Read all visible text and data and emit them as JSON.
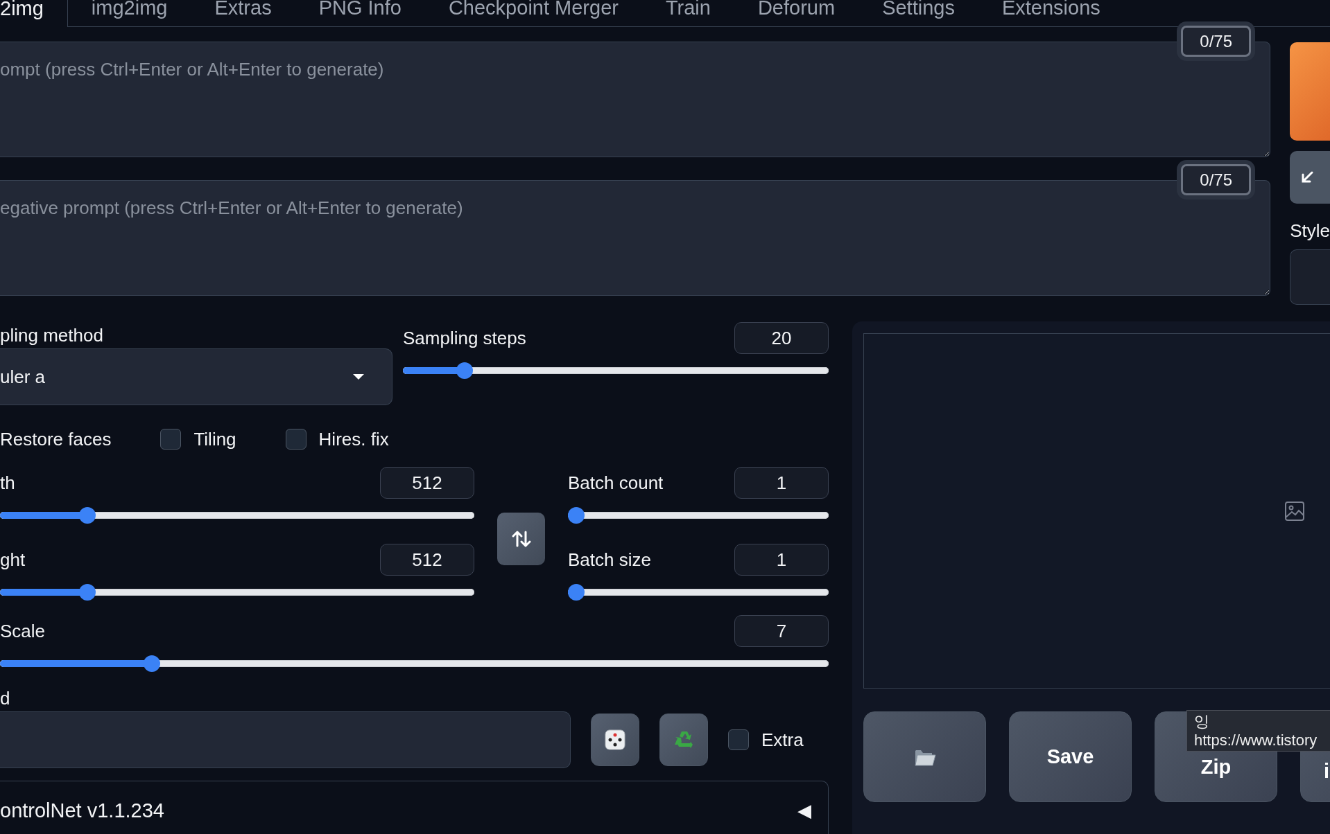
{
  "tabs": [
    {
      "label": "2img",
      "selected": true
    },
    {
      "label": "img2img",
      "selected": false
    },
    {
      "label": "Extras",
      "selected": false
    },
    {
      "label": "PNG Info",
      "selected": false
    },
    {
      "label": "Checkpoint Merger",
      "selected": false
    },
    {
      "label": "Train",
      "selected": false
    },
    {
      "label": "Deforum",
      "selected": false
    },
    {
      "label": "Settings",
      "selected": false
    },
    {
      "label": "Extensions",
      "selected": false
    }
  ],
  "prompt": {
    "placeholder": "ompt (press Ctrl+Enter or Alt+Enter to generate)",
    "token_count": "0/75"
  },
  "negative_prompt": {
    "placeholder": "egative prompt (press Ctrl+Enter or Alt+Enter to generate)",
    "token_count": "0/75"
  },
  "side": {
    "style_label": "Style"
  },
  "sampling_method": {
    "label": "pling method",
    "value": "uler a"
  },
  "sampling_steps": {
    "label": "Sampling steps",
    "value": "20",
    "level": 0.13
  },
  "checkboxes": [
    {
      "label": "Restore faces"
    },
    {
      "label": "Tiling",
      "checked": false
    },
    {
      "label": "Hires. fix",
      "checked": false
    }
  ],
  "width": {
    "label": "th",
    "value": "512",
    "level": 0.173
  },
  "height": {
    "label": "ght",
    "value": "512",
    "level": 0.173
  },
  "batch_count": {
    "label": "Batch count",
    "value": "1",
    "level": 0
  },
  "batch_size": {
    "label": "Batch size",
    "value": "1",
    "level": 0
  },
  "cfg_scale": {
    "label": "Scale",
    "value": "7",
    "level": 0.177
  },
  "seed": {
    "label": "d",
    "extra": {
      "label": "Extra",
      "checked": false
    }
  },
  "controlnet": {
    "title": "ontrolNet v1.1.234",
    "toggle": "◀"
  },
  "output_buttons": [
    {
      "kind": "folder"
    },
    {
      "kind": "text",
      "label": "Save"
    },
    {
      "kind": "text",
      "label": "Zip"
    },
    {
      "kind": "text",
      "label": "i"
    }
  ],
  "tooltip": {
    "lines": [
      "잉",
      "https://www.tistory"
    ]
  }
}
